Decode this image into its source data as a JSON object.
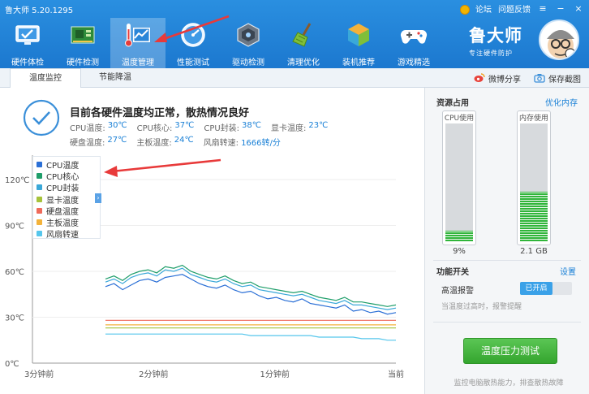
{
  "app": {
    "title": "鲁大师 5.20.1295",
    "links": [
      "论坛",
      "问题反馈"
    ],
    "brand_name": "鲁大师",
    "brand_slogan": "专注硬件防护"
  },
  "nav": [
    {
      "label": "硬件体检",
      "icon": "monitor-check-icon"
    },
    {
      "label": "硬件检测",
      "icon": "circuit-board-icon"
    },
    {
      "label": "温度管理",
      "icon": "thermometer-chart-icon",
      "active": true
    },
    {
      "label": "性能测试",
      "icon": "speedometer-icon"
    },
    {
      "label": "驱动检测",
      "icon": "driver-chip-icon"
    },
    {
      "label": "清理优化",
      "icon": "broom-icon"
    },
    {
      "label": "装机推荐",
      "icon": "cube-icon"
    },
    {
      "label": "游戏精选",
      "icon": "gamepad-icon"
    }
  ],
  "tabs": {
    "temp": "温度监控",
    "power": "节能降温",
    "share": "微博分享",
    "save": "保存截图"
  },
  "status": {
    "headline": "目前各硬件温度均正常，散热情况良好",
    "row1": [
      {
        "label": "CPU温度:",
        "value": "30℃"
      },
      {
        "label": "CPU核心:",
        "value": "37℃"
      },
      {
        "label": "CPU封装:",
        "value": "38℃"
      },
      {
        "label": "显卡温度:",
        "value": "23℃"
      }
    ],
    "row2": [
      {
        "label": "硬盘温度:",
        "value": "27℃"
      },
      {
        "label": "主板温度:",
        "value": "24℃"
      },
      {
        "label": "风扇转速:",
        "value": "1666转/分"
      }
    ]
  },
  "legend": [
    {
      "name": "CPU温度",
      "color": "#2a6fd6"
    },
    {
      "name": "CPU核心",
      "color": "#1f9e6a"
    },
    {
      "name": "CPU封装",
      "color": "#3aa8d8"
    },
    {
      "name": "显卡温度",
      "color": "#a6c23a"
    },
    {
      "name": "硬盘温度",
      "color": "#ef6a5a"
    },
    {
      "name": "主板温度",
      "color": "#f3b23a"
    },
    {
      "name": "风扇转速",
      "color": "#55c6ec"
    }
  ],
  "chart_data": {
    "type": "line",
    "yticks": [
      "120℃",
      "90℃",
      "60℃",
      "30℃",
      "0℃"
    ],
    "ylim": [
      0,
      120
    ],
    "xticks": [
      "3分钟前",
      "2分钟前",
      "1分钟前",
      "当前"
    ],
    "grid": true,
    "legend_position": "top-left",
    "series": [
      {
        "name": "CPU温度",
        "color": "#2a6fd6",
        "values": [
          50,
          52,
          48,
          51,
          54,
          55,
          53,
          56,
          57,
          58,
          55,
          52,
          50,
          49,
          51,
          48,
          46,
          47,
          44,
          42,
          43,
          41,
          40,
          42,
          39,
          38,
          37,
          36,
          38,
          34,
          35,
          33,
          34,
          32,
          33
        ]
      },
      {
        "name": "CPU核心",
        "color": "#1f9e6a",
        "values": [
          55,
          57,
          54,
          58,
          60,
          61,
          59,
          63,
          62,
          64,
          60,
          58,
          56,
          55,
          57,
          54,
          52,
          53,
          50,
          49,
          48,
          47,
          46,
          47,
          45,
          43,
          42,
          41,
          43,
          40,
          40,
          39,
          38,
          37,
          38
        ]
      },
      {
        "name": "CPU封装",
        "color": "#3aa8d8",
        "values": [
          53,
          55,
          52,
          56,
          58,
          59,
          57,
          61,
          60,
          62,
          58,
          56,
          54,
          53,
          55,
          52,
          50,
          51,
          48,
          47,
          46,
          45,
          44,
          45,
          43,
          41,
          40,
          39,
          41,
          38,
          38,
          37,
          36,
          35,
          36
        ]
      },
      {
        "name": "显卡温度",
        "color": "#a6c23a",
        "values": [
          23,
          23,
          23,
          23,
          23,
          23,
          23,
          23,
          23,
          23,
          23,
          23,
          23,
          23,
          23,
          23,
          23,
          23,
          23,
          23,
          23,
          23,
          23,
          23,
          23,
          23,
          23,
          23,
          23,
          23,
          23,
          23,
          23,
          23,
          23
        ]
      },
      {
        "name": "硬盘温度",
        "color": "#ef6a5a",
        "values": [
          28,
          28,
          28,
          28,
          28,
          28,
          28,
          28,
          28,
          28,
          28,
          28,
          28,
          28,
          28,
          28,
          28,
          28,
          28,
          28,
          28,
          28,
          28,
          28,
          28,
          28,
          28,
          28,
          28,
          28,
          28,
          28,
          28,
          28,
          28
        ]
      },
      {
        "name": "主板温度",
        "color": "#f3b23a",
        "values": [
          25,
          25,
          25,
          25,
          25,
          25,
          25,
          25,
          25,
          25,
          25,
          25,
          25,
          25,
          25,
          25,
          25,
          25,
          25,
          25,
          25,
          25,
          25,
          25,
          25,
          25,
          25,
          25,
          25,
          25,
          25,
          25,
          25,
          25,
          25
        ]
      },
      {
        "name": "风扇转速",
        "color": "#55c6ec",
        "values": [
          19,
          19,
          19,
          19,
          19,
          19,
          19,
          19,
          19,
          19,
          19,
          19,
          19,
          19,
          19,
          19,
          19,
          18,
          18,
          18,
          18,
          18,
          18,
          18,
          18,
          17,
          17,
          17,
          17,
          17,
          16,
          16,
          16,
          15,
          15
        ]
      }
    ]
  },
  "resources": {
    "title": "资源占用",
    "optimize": "优化内存",
    "cpu_label": "CPU使用",
    "cpu_value": "9%",
    "cpu_level": 0.09,
    "mem_label": "内存使用",
    "mem_value": "2.1 GB",
    "mem_level": 0.42
  },
  "functions": {
    "title": "功能开关",
    "settings": "设置",
    "alarm_label": "高温报警",
    "alarm_state": "已开启",
    "alarm_note": "当温度过高时，报警提醒"
  },
  "stress": {
    "button": "温度压力测试",
    "note": "监控电脑散热能力，排查散热故障"
  },
  "colors": {
    "accent": "#1c78cf",
    "green_button": "#34a52e"
  }
}
